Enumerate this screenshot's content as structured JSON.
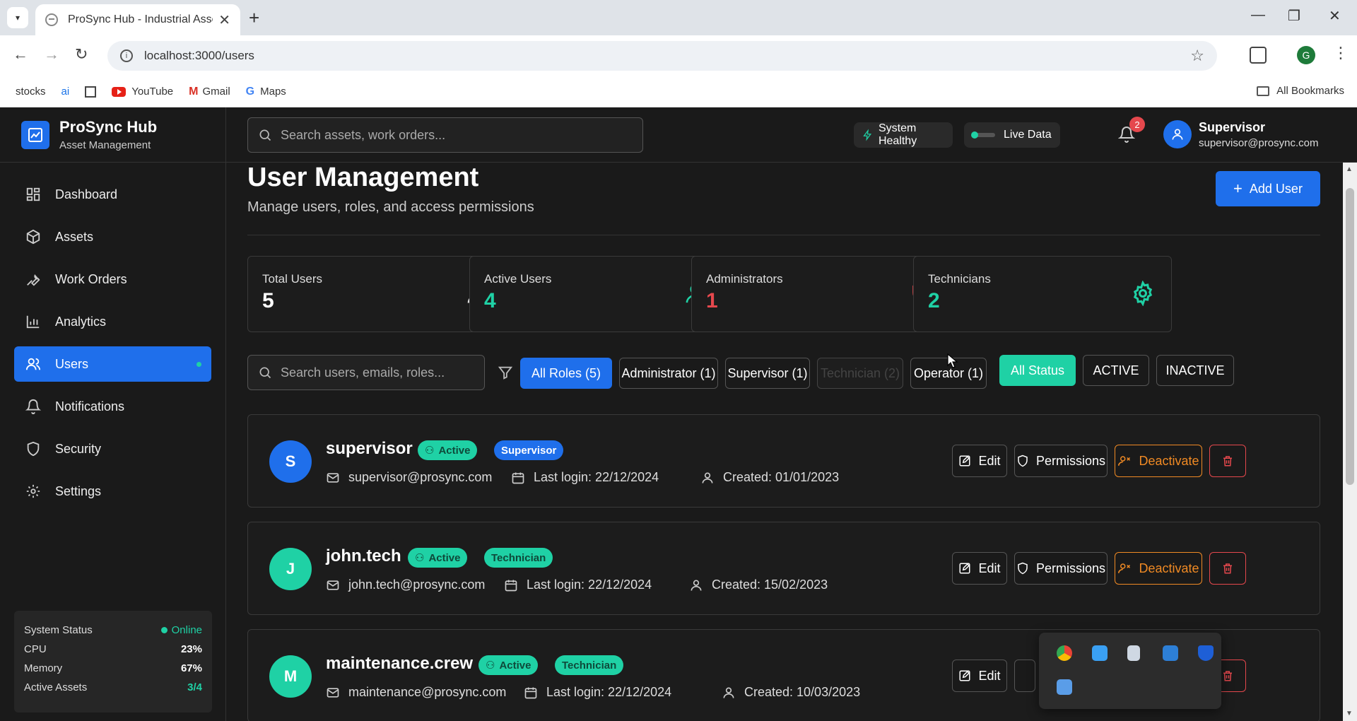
{
  "browser": {
    "tab_title": "ProSync Hub - Industrial Asset Management",
    "url": "localhost:3000/users",
    "bookmarks": [
      "stocks",
      "ai",
      "YouTube",
      "Gmail",
      "Maps"
    ],
    "all_bookmarks": "All Bookmarks",
    "profile_initial": "G"
  },
  "brand": {
    "title": "ProSync Hub",
    "subtitle": "Asset Management"
  },
  "sidebar": {
    "items": [
      {
        "label": "Dashboard",
        "icon": "dashboard-icon"
      },
      {
        "label": "Assets",
        "icon": "box-icon"
      },
      {
        "label": "Work Orders",
        "icon": "wrench-icon"
      },
      {
        "label": "Analytics",
        "icon": "bar-chart-icon"
      },
      {
        "label": "Users",
        "icon": "users-icon",
        "active": true
      },
      {
        "label": "Notifications",
        "icon": "bell-icon"
      },
      {
        "label": "Security",
        "icon": "shield-icon"
      },
      {
        "label": "Settings",
        "icon": "gear-icon"
      }
    ],
    "system_status": {
      "title": "System Status",
      "state": "Online",
      "cpu_label": "CPU",
      "cpu": "23%",
      "memory_label": "Memory",
      "memory": "67%",
      "assets_label": "Active Assets",
      "assets": "3/4"
    }
  },
  "topbar": {
    "search_placeholder": "Search assets, work orders...",
    "system_health": "System Healthy",
    "live_data": "Live Data",
    "notification_count": "2",
    "user_name": "Supervisor",
    "user_email": "supervisor@prosync.com"
  },
  "page": {
    "title": "User Management",
    "subtitle": "Manage users, roles, and access permissions",
    "add_button": "Add User"
  },
  "stats": [
    {
      "label": "Total Users",
      "value": "5",
      "color": "#ffffff",
      "icon": "user-icon"
    },
    {
      "label": "Active Users",
      "value": "4",
      "color": "#1fd1a5",
      "icon": "user-check-icon"
    },
    {
      "label": "Administrators",
      "value": "1",
      "color": "#e5484d",
      "icon": "shield-icon"
    },
    {
      "label": "Technicians",
      "value": "2",
      "color": "#1fd1a5",
      "icon": "gear-icon"
    }
  ],
  "filters": {
    "search_placeholder": "Search users, emails, roles...",
    "roles": [
      "All Roles (5)",
      "Administrator (1)",
      "Supervisor (1)",
      "Technician (2)",
      "Operator (1)"
    ],
    "statuses": [
      "All Status",
      "ACTIVE",
      "INACTIVE"
    ]
  },
  "users": [
    {
      "initial": "S",
      "name": "supervisor",
      "status": "Active",
      "role": "Supervisor",
      "email": "supervisor@prosync.com",
      "last_login": "Last login: 22/12/2024",
      "created": "Created: 01/01/2023",
      "avatar_color": "#1f6feb"
    },
    {
      "initial": "J",
      "name": "john.tech",
      "status": "Active",
      "role": "Technician",
      "email": "john.tech@prosync.com",
      "last_login": "Last login: 22/12/2024",
      "created": "Created: 15/02/2023",
      "avatar_color": "#1fd1a5"
    },
    {
      "initial": "M",
      "name": "maintenance.crew",
      "status": "Active",
      "role": "Technician",
      "email": "maintenance@prosync.com",
      "last_login": "Last login: 22/12/2024",
      "created": "Created: 10/03/2023",
      "avatar_color": "#1fd1a5"
    }
  ],
  "actions": {
    "edit": "Edit",
    "permissions": "Permissions",
    "deactivate": "Deactivate",
    "deactivate_partial": "vate"
  }
}
